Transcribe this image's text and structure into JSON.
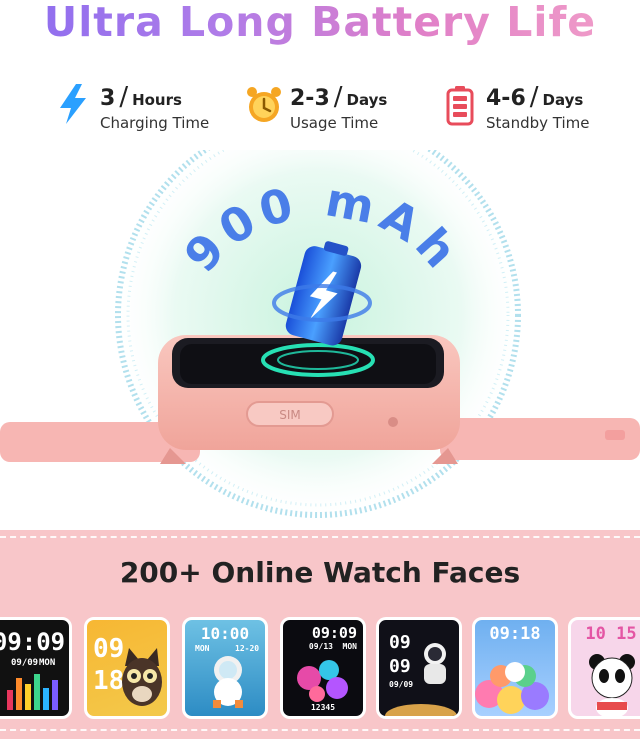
{
  "headline": "Ultra Long Battery Life",
  "stats": [
    {
      "value": "3",
      "unit": "Hours",
      "label": "Charging Time",
      "icon": "lightning-icon",
      "color": "#2aa0ff"
    },
    {
      "value": "2-3",
      "unit": "Days",
      "label": "Usage Time",
      "icon": "alarm-clock-icon",
      "color": "#f5a623"
    },
    {
      "value": "4-6",
      "unit": "Days",
      "label": "Standby Time",
      "icon": "battery-icon",
      "color": "#e84c5b"
    }
  ],
  "battery_capacity": "900 mAh",
  "sim_label": "SIM",
  "faces_heading": "200+ Online Watch Faces",
  "faces": [
    {
      "time": "09:09",
      "date": "09/09",
      "day": "MON"
    },
    {
      "time": "09",
      "time2": "18"
    },
    {
      "time": "10:00",
      "date": "MON",
      "date2": "12-20"
    },
    {
      "time": "09:09",
      "date": "09/13",
      "day": "MON",
      "steps": "12345"
    },
    {
      "time": "09",
      "time2": "09",
      "date": "09/09"
    },
    {
      "time": "09:18"
    },
    {
      "time": "10 15"
    }
  ]
}
